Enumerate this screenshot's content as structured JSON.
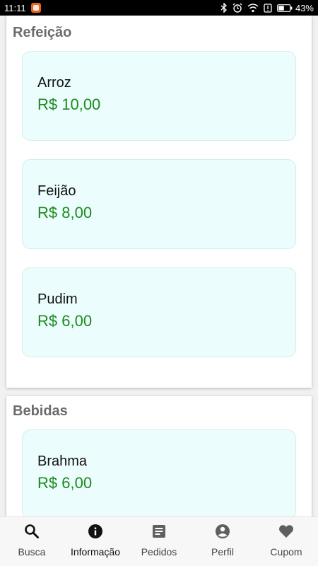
{
  "status_bar": {
    "time": "11:11",
    "battery": "43%",
    "icons": [
      "bluetooth-icon",
      "alarm-icon",
      "wifi-icon",
      "alert-icon",
      "battery-icon"
    ]
  },
  "sections": [
    {
      "title": "Refeição",
      "items": [
        {
          "name": "Arroz",
          "price": "R$ 10,00"
        },
        {
          "name": "Feijão",
          "price": "R$ 8,00"
        },
        {
          "name": "Pudim",
          "price": "R$ 6,00"
        }
      ]
    },
    {
      "title": "Bebidas",
      "items": [
        {
          "name": "Brahma",
          "price": "R$ 6,00"
        }
      ]
    }
  ],
  "bottom_nav": [
    {
      "label": "Busca",
      "icon": "search-icon"
    },
    {
      "label": "Informação",
      "icon": "info-icon",
      "active": true
    },
    {
      "label": "Pedidos",
      "icon": "receipt-icon"
    },
    {
      "label": "Perfil",
      "icon": "person-icon"
    },
    {
      "label": "Cupom",
      "icon": "heart-icon"
    }
  ],
  "colors": {
    "price": "#1b8a1b",
    "card_background": "#ecfdfd",
    "active_icon": "#111111",
    "inactive_icon": "#5f5f5f"
  }
}
